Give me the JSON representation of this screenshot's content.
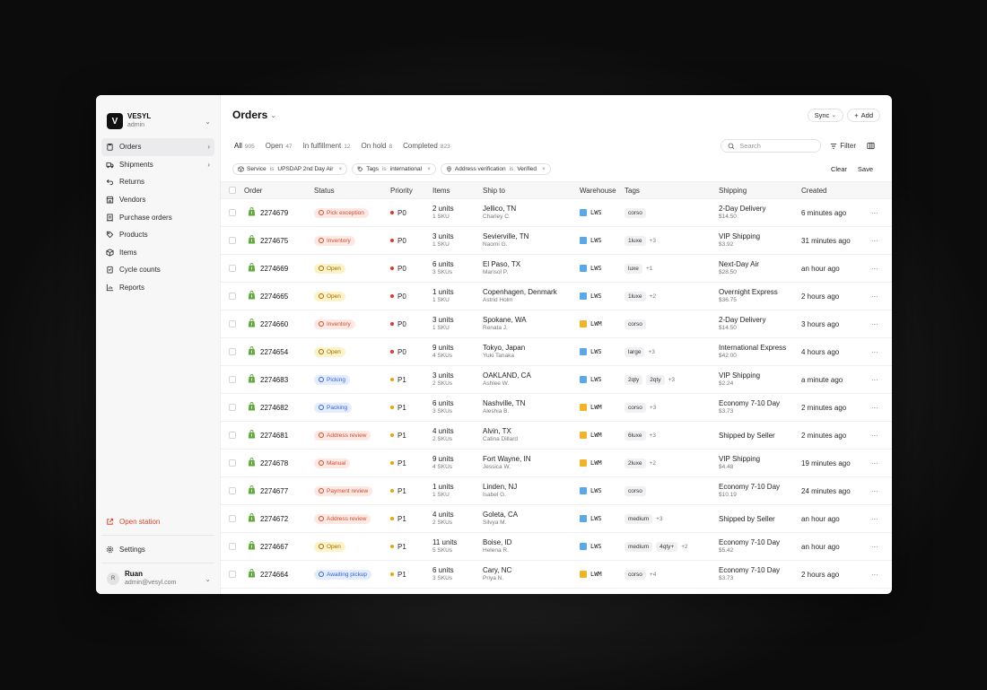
{
  "workspace": {
    "logo": "V",
    "name": "VESYL",
    "role": "admin"
  },
  "nav": [
    {
      "label": "Orders",
      "icon": "clipboard-icon",
      "active": true,
      "caret": true
    },
    {
      "label": "Shipments",
      "icon": "truck-icon",
      "caret": true
    },
    {
      "label": "Returns",
      "icon": "return-icon"
    },
    {
      "label": "Vendors",
      "icon": "store-icon"
    },
    {
      "label": "Purchase orders",
      "icon": "receipt-icon"
    },
    {
      "label": "Products",
      "icon": "tag-icon"
    },
    {
      "label": "Items",
      "icon": "box-icon"
    },
    {
      "label": "Cycle counts",
      "icon": "checklist-icon"
    },
    {
      "label": "Reports",
      "icon": "chart-icon"
    }
  ],
  "sidebar_bottom": {
    "open_station": "Open station",
    "settings": "Settings",
    "user": {
      "initial": "R",
      "name": "Ruan",
      "email": "admin@vesyl.com"
    }
  },
  "header": {
    "title": "Orders",
    "sync": "Sync",
    "add": "Add"
  },
  "tabs": [
    {
      "label": "All",
      "count": "905",
      "active": true
    },
    {
      "label": "Open",
      "count": "47"
    },
    {
      "label": "In fulfillment",
      "count": "12"
    },
    {
      "label": "On hold",
      "count": "8"
    },
    {
      "label": "Completed",
      "count": "823"
    }
  ],
  "search": {
    "placeholder": "Search"
  },
  "filter_label": "Filter",
  "filters": [
    {
      "field": "Service",
      "op": "is",
      "value": "UPSDAP 2nd Day Air",
      "icon": "box-icon"
    },
    {
      "field": "Tags",
      "op": "is",
      "value": "international",
      "icon": "tag-icon"
    },
    {
      "field": "Address verification",
      "op": "is",
      "value": "Verified",
      "icon": "pin-icon"
    }
  ],
  "filter_actions": {
    "clear": "Clear",
    "save": "Save"
  },
  "columns": [
    "Order",
    "Status",
    "Priority",
    "Items",
    "Ship to",
    "Warehouse",
    "Tags",
    "Shipping",
    "Created"
  ],
  "colors": {
    "red": "#d9472b",
    "yellow": "#a06b00",
    "blue": "#3563d8",
    "p0": "#e0362c",
    "p1": "#f0a100",
    "lws": "#5aa9e6",
    "lwm": "#f0b429",
    "shopify": "#5fa83a"
  },
  "rows": [
    {
      "order": "2274679",
      "status": "Pick exception",
      "tone": "red",
      "priority": "P0",
      "units": "2 units",
      "skus": "1 SKU",
      "city": "Jellico, TN",
      "name": "Charley C.",
      "warehouse": "LWS",
      "tags": [
        "corso"
      ],
      "more": "",
      "service": "2-Day Delivery",
      "price": "$14.50",
      "created": "6 minutes ago"
    },
    {
      "order": "2274675",
      "status": "Inventory",
      "tone": "red",
      "priority": "P0",
      "units": "3 units",
      "skus": "1 SKU",
      "city": "Sevierville, TN",
      "name": "Naomi G.",
      "warehouse": "LWS",
      "tags": [
        "1luxe"
      ],
      "more": "+3",
      "service": "VIP Shipping",
      "price": "$3.92",
      "created": "31 minutes ago"
    },
    {
      "order": "2274669",
      "status": "Open",
      "tone": "yellow",
      "priority": "P0",
      "units": "6 units",
      "skus": "3 SKUs",
      "city": "El Paso, TX",
      "name": "Marisol P.",
      "warehouse": "LWS",
      "tags": [
        "luxe"
      ],
      "more": "+1",
      "service": "Next-Day Air",
      "price": "$28.50",
      "created": "an hour ago"
    },
    {
      "order": "2274665",
      "status": "Open",
      "tone": "yellow",
      "priority": "P0",
      "units": "1 units",
      "skus": "1 SKU",
      "city": "Copenhagen, Denmark",
      "name": "Astrid Holm",
      "warehouse": "LWS",
      "tags": [
        "1luxe"
      ],
      "more": "+2",
      "service": "Overnight Express",
      "price": "$36.75",
      "created": "2 hours ago"
    },
    {
      "order": "2274660",
      "status": "Inventory",
      "tone": "red",
      "priority": "P0",
      "units": "3 units",
      "skus": "1 SKU",
      "city": "Spokane, WA",
      "name": "Renata J.",
      "warehouse": "LWM",
      "tags": [
        "corso"
      ],
      "more": "",
      "service": "2-Day Delivery",
      "price": "$14.50",
      "created": "3 hours ago"
    },
    {
      "order": "2274654",
      "status": "Open",
      "tone": "yellow",
      "priority": "P0",
      "units": "9 units",
      "skus": "4 SKUs",
      "city": "Tokyo, Japan",
      "name": "Yuki Tanaka",
      "warehouse": "LWS",
      "tags": [
        "large"
      ],
      "more": "+3",
      "service": "International Express",
      "price": "$42.00",
      "created": "4 hours ago"
    },
    {
      "order": "2274683",
      "status": "Picking",
      "tone": "blue",
      "priority": "P1",
      "units": "3 units",
      "skus": "2 SKUs",
      "city": "OAKLAND, CA",
      "name": "Ashlee W.",
      "warehouse": "LWS",
      "tags": [
        "2qty",
        "2qty"
      ],
      "more": "+3",
      "service": "VIP Shipping",
      "price": "$2.24",
      "created": "a minute ago"
    },
    {
      "order": "2274682",
      "status": "Packing",
      "tone": "blue",
      "priority": "P1",
      "units": "6 units",
      "skus": "3 SKUs",
      "city": "Nashville, TN",
      "name": "Aleshia B.",
      "warehouse": "LWM",
      "tags": [
        "corso"
      ],
      "more": "+3",
      "service": "Economy 7-10 Day",
      "price": "$3.73",
      "created": "2 minutes ago"
    },
    {
      "order": "2274681",
      "status": "Address review",
      "tone": "red",
      "priority": "P1",
      "units": "4 units",
      "skus": "2 SKUs",
      "city": "Alvin, TX",
      "name": "Catina Dillard",
      "warehouse": "LWM",
      "tags": [
        "6luxe"
      ],
      "more": "+3",
      "service": "Shipped by Seller",
      "price": "",
      "created": "2 minutes ago"
    },
    {
      "order": "2274678",
      "status": "Manual",
      "tone": "red",
      "priority": "P1",
      "units": "9 units",
      "skus": "4 SKUs",
      "city": "Fort Wayne, IN",
      "name": "Jessica W.",
      "warehouse": "LWM",
      "tags": [
        "2luxe"
      ],
      "more": "+2",
      "service": "VIP Shipping",
      "price": "$4.48",
      "created": "19 minutes ago"
    },
    {
      "order": "2274677",
      "status": "Payment review",
      "tone": "red",
      "priority": "P1",
      "units": "1 units",
      "skus": "1 SKU",
      "city": "Linden, NJ",
      "name": "Isabel G.",
      "warehouse": "LWS",
      "tags": [
        "corso"
      ],
      "more": "",
      "service": "Economy 7-10 Day",
      "price": "$10.19",
      "created": "24 minutes ago"
    },
    {
      "order": "2274672",
      "status": "Address review",
      "tone": "red",
      "priority": "P1",
      "units": "4 units",
      "skus": "2 SKUs",
      "city": "Goleta, CA",
      "name": "Silvya M.",
      "warehouse": "LWS",
      "tags": [
        "medium"
      ],
      "more": "+3",
      "service": "Shipped by Seller",
      "price": "",
      "created": "an hour ago"
    },
    {
      "order": "2274667",
      "status": "Open",
      "tone": "yellow",
      "priority": "P1",
      "units": "11 units",
      "skus": "5 SKUs",
      "city": "Boise, ID",
      "name": "Helena R.",
      "warehouse": "LWS",
      "tags": [
        "medium",
        "4qty+"
      ],
      "more": "+2",
      "service": "Economy 7-10 Day",
      "price": "$5.42",
      "created": "an hour ago"
    },
    {
      "order": "2274664",
      "status": "Awaiting pickup",
      "tone": "blue",
      "priority": "P1",
      "units": "6 units",
      "skus": "3 SKUs",
      "city": "Cary, NC",
      "name": "Priya N.",
      "warehouse": "LWM",
      "tags": [
        "corso"
      ],
      "more": "+4",
      "service": "Economy 7-10 Day",
      "price": "$3.73",
      "created": "2 hours ago"
    }
  ],
  "row_menu": "···"
}
